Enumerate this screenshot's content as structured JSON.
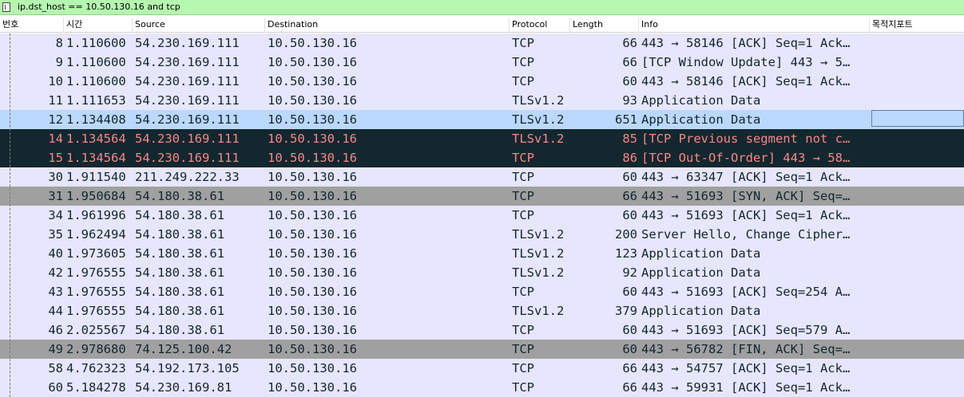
{
  "filter": {
    "text": "ip.dst_host == 10.50.130.16 and tcp"
  },
  "columns": [
    "번호",
    "시간",
    "Source",
    "Destination",
    "Protocol",
    "Length",
    "Info",
    "목적지포트"
  ],
  "colors": {
    "filter_bg": "#b6f7b0",
    "row_default": "#e7e6ff",
    "row_syn_fin": "#a0a0a0",
    "row_selected": "#bbd8ff",
    "row_bad": "#12272e",
    "row_bad_text": "#f78787"
  },
  "packets": [
    {
      "no": "8",
      "time": "1.110600",
      "src": "54.230.169.111",
      "dst": "10.50.130.16",
      "proto": "TCP",
      "len": "66",
      "info": "443 → 58146 [ACK] Seq=1 Ack…",
      "style": "default"
    },
    {
      "no": "9",
      "time": "1.110600",
      "src": "54.230.169.111",
      "dst": "10.50.130.16",
      "proto": "TCP",
      "len": "66",
      "info": "[TCP Window Update] 443 → 5…",
      "style": "default"
    },
    {
      "no": "10",
      "time": "1.110600",
      "src": "54.230.169.111",
      "dst": "10.50.130.16",
      "proto": "TCP",
      "len": "60",
      "info": "443 → 58146 [ACK] Seq=1 Ack…",
      "style": "default"
    },
    {
      "no": "11",
      "time": "1.111653",
      "src": "54.230.169.111",
      "dst": "10.50.130.16",
      "proto": "TLSv1.2",
      "len": "93",
      "info": "Application Data",
      "style": "default"
    },
    {
      "no": "12",
      "time": "1.134408",
      "src": "54.230.169.111",
      "dst": "10.50.130.16",
      "proto": "TLSv1.2",
      "len": "651",
      "info": "Application Data",
      "style": "selected"
    },
    {
      "no": "14",
      "time": "1.134564",
      "src": "54.230.169.111",
      "dst": "10.50.130.16",
      "proto": "TLSv1.2",
      "len": "85",
      "info": "[TCP Previous segment not c…",
      "style": "bad"
    },
    {
      "no": "15",
      "time": "1.134564",
      "src": "54.230.169.111",
      "dst": "10.50.130.16",
      "proto": "TCP",
      "len": "86",
      "info": "[TCP Out-Of-Order] 443 → 58…",
      "style": "bad"
    },
    {
      "no": "30",
      "time": "1.911540",
      "src": "211.249.222.33",
      "dst": "10.50.130.16",
      "proto": "TCP",
      "len": "60",
      "info": "443 → 63347 [ACK] Seq=1 Ack…",
      "style": "default"
    },
    {
      "no": "31",
      "time": "1.950684",
      "src": "54.180.38.61",
      "dst": "10.50.130.16",
      "proto": "TCP",
      "len": "66",
      "info": "443 → 51693 [SYN, ACK] Seq=…",
      "style": "syn"
    },
    {
      "no": "34",
      "time": "1.961996",
      "src": "54.180.38.61",
      "dst": "10.50.130.16",
      "proto": "TCP",
      "len": "60",
      "info": "443 → 51693 [ACK] Seq=1 Ack…",
      "style": "default"
    },
    {
      "no": "35",
      "time": "1.962494",
      "src": "54.180.38.61",
      "dst": "10.50.130.16",
      "proto": "TLSv1.2",
      "len": "200",
      "info": "Server Hello, Change Cipher…",
      "style": "default"
    },
    {
      "no": "40",
      "time": "1.973605",
      "src": "54.180.38.61",
      "dst": "10.50.130.16",
      "proto": "TLSv1.2",
      "len": "123",
      "info": "Application Data",
      "style": "default"
    },
    {
      "no": "42",
      "time": "1.976555",
      "src": "54.180.38.61",
      "dst": "10.50.130.16",
      "proto": "TLSv1.2",
      "len": "92",
      "info": "Application Data",
      "style": "default"
    },
    {
      "no": "43",
      "time": "1.976555",
      "src": "54.180.38.61",
      "dst": "10.50.130.16",
      "proto": "TCP",
      "len": "60",
      "info": "443 → 51693 [ACK] Seq=254 A…",
      "style": "default"
    },
    {
      "no": "44",
      "time": "1.976555",
      "src": "54.180.38.61",
      "dst": "10.50.130.16",
      "proto": "TLSv1.2",
      "len": "379",
      "info": "Application Data",
      "style": "default"
    },
    {
      "no": "46",
      "time": "2.025567",
      "src": "54.180.38.61",
      "dst": "10.50.130.16",
      "proto": "TCP",
      "len": "60",
      "info": "443 → 51693 [ACK] Seq=579 A…",
      "style": "default"
    },
    {
      "no": "49",
      "time": "2.978680",
      "src": "74.125.100.42",
      "dst": "10.50.130.16",
      "proto": "TCP",
      "len": "60",
      "info": "443 → 56782 [FIN, ACK] Seq=…",
      "style": "syn"
    },
    {
      "no": "58",
      "time": "4.762323",
      "src": "54.192.173.105",
      "dst": "10.50.130.16",
      "proto": "TCP",
      "len": "66",
      "info": "443 → 54757 [ACK] Seq=1 Ack…",
      "style": "default"
    },
    {
      "no": "60",
      "time": "5.184278",
      "src": "54.230.169.81",
      "dst": "10.50.130.16",
      "proto": "TCP",
      "len": "66",
      "info": "443 → 59931 [ACK] Seq=1 Ack…",
      "style": "default"
    }
  ]
}
